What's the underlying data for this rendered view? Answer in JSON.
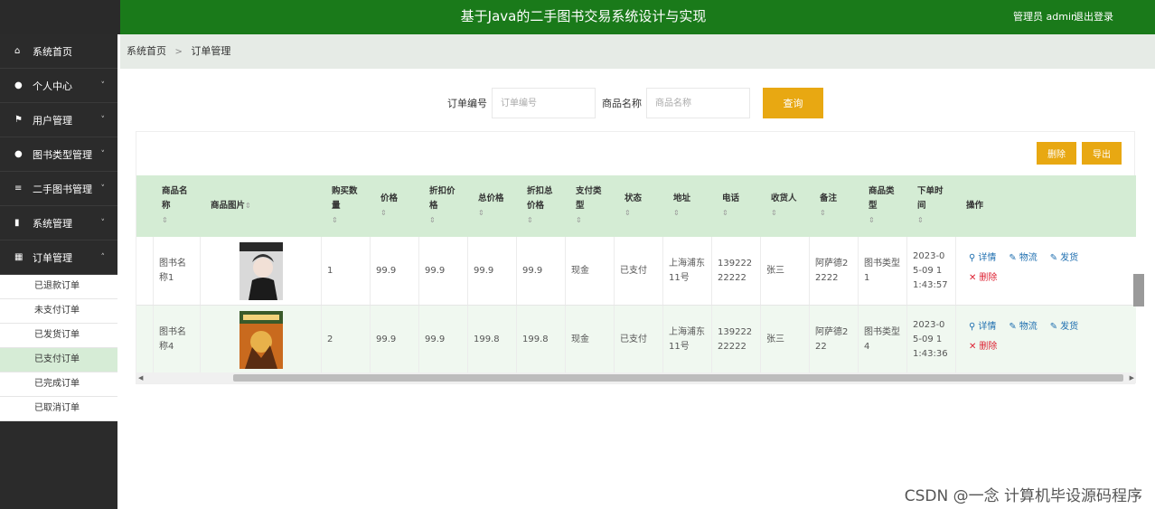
{
  "header": {
    "title": "基于Java的二手图书交易系统设计与实现",
    "user": "管理员 admin",
    "logout": "退出登录"
  },
  "sidebar": {
    "items": [
      {
        "label": "系统首页",
        "icon": "home-icon",
        "chevron": ""
      },
      {
        "label": "个人中心",
        "icon": "user-icon",
        "chevron": "˅"
      },
      {
        "label": "用户管理",
        "icon": "flag-icon",
        "chevron": "˅"
      },
      {
        "label": "图书类型管理",
        "icon": "user-icon",
        "chevron": "˅"
      },
      {
        "label": "二手图书管理",
        "icon": "sliders-icon",
        "chevron": "˅"
      },
      {
        "label": "系统管理",
        "icon": "chart-icon",
        "chevron": "˅"
      },
      {
        "label": "订单管理",
        "icon": "grid-icon",
        "chevron": "˄"
      }
    ],
    "sub_items": [
      "已退款订单",
      "未支付订单",
      "已发货订单",
      "已支付订单",
      "已完成订单",
      "已取消订单"
    ],
    "active_sub": "已支付订单"
  },
  "breadcrumb": {
    "home": "系统首页",
    "separator": ">",
    "current": "订单管理"
  },
  "search": {
    "order_no_label": "订单编号",
    "order_no_placeholder": "订单编号",
    "product_name_label": "商品名称",
    "product_name_placeholder": "商品名称",
    "query_button": "查询"
  },
  "toolbar": {
    "delete_button": "删除",
    "export_button": "导出"
  },
  "table": {
    "columns": [
      "商品名称",
      "商品图片",
      "购买数量",
      "价格",
      "折扣价格",
      "总价格",
      "折扣总价格",
      "支付类型",
      "状态",
      "地址",
      "电话",
      "收货人",
      "备注",
      "商品类型",
      "下单时间",
      "操作"
    ],
    "sort_glyph": "⇕",
    "rows": [
      {
        "name": "图书名称1",
        "qty": "1",
        "price": "99.9",
        "discount_price": "99.9",
        "total": "99.9",
        "discount_total": "99.9",
        "pay_type": "现金",
        "status": "已支付",
        "address": "上海浦东11号",
        "phone": "13922222222",
        "receiver": "张三",
        "remark": "阿萨德22222",
        "type": "图书类型1",
        "time": "2023-05-09 11:43:57"
      },
      {
        "name": "图书名称4",
        "qty": "2",
        "price": "99.9",
        "discount_price": "99.9",
        "total": "199.8",
        "discount_total": "199.8",
        "pay_type": "现金",
        "status": "已支付",
        "address": "上海浦东11号",
        "phone": "13922222222",
        "receiver": "张三",
        "remark": "阿萨德222",
        "type": "图书类型4",
        "time": "2023-05-09 11:43:36"
      }
    ],
    "actions": {
      "detail": "详情",
      "logistics": "物流",
      "ship": "发货",
      "delete": "删除"
    }
  },
  "watermark": "CSDN @一念 计算机毕设源码程序"
}
